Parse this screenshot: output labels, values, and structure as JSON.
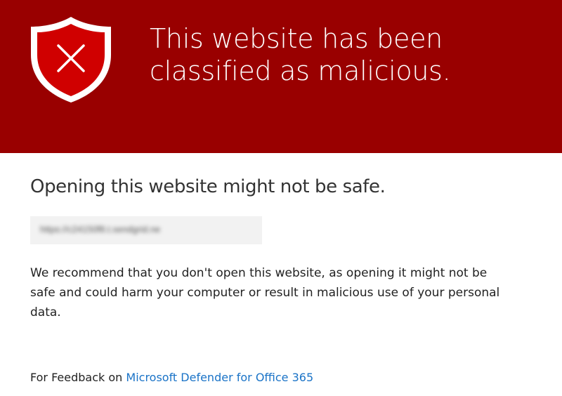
{
  "banner": {
    "headline_line1": "This website has been",
    "headline_line2": "classified as malicious.",
    "icon": "shield-x-icon",
    "background_color": "#990000"
  },
  "main": {
    "subtitle": "Opening this website might not be safe.",
    "url_blurred": "https://c24150f8.t.sendgrid.ne",
    "recommendation": "We recommend that you don't open this website, as opening it might not be safe and could harm your computer or result in malicious use of your personal data."
  },
  "footer": {
    "feedback_prefix": "For Feedback on",
    "feedback_link": "Microsoft Defender for Office 365",
    "link_color": "#1a73c7"
  }
}
